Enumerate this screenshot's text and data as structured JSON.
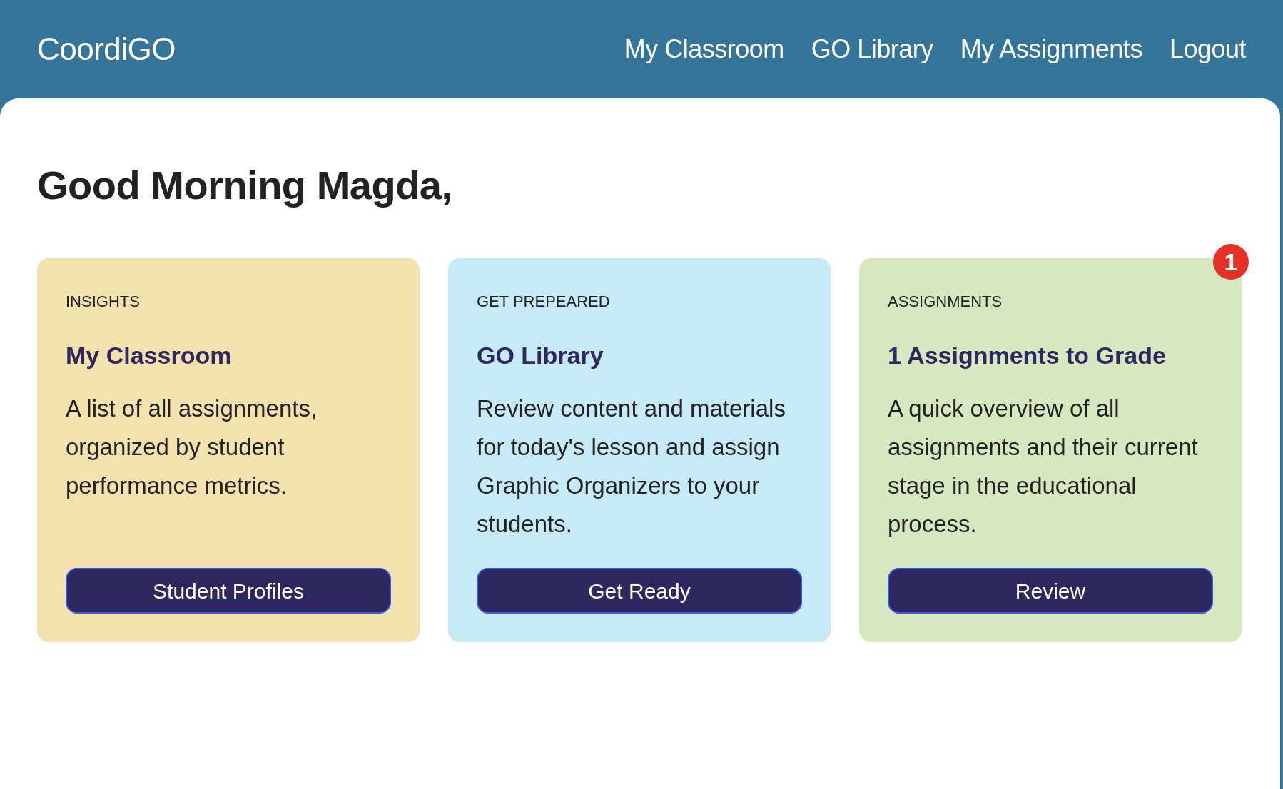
{
  "brand": "CoordiGO",
  "nav": [
    {
      "label": "My Classroom"
    },
    {
      "label": "GO Library"
    },
    {
      "label": "My Assignments"
    },
    {
      "label": "Logout"
    }
  ],
  "greeting": "Good Morning Magda,",
  "cards": [
    {
      "category": "INSIGHTS",
      "title": "My Classroom",
      "description": "A list of all assignments, organized by student performance metrics.",
      "button": "Student Profiles",
      "color": "#f3e2ae"
    },
    {
      "category": "GET PREPEARED",
      "title": "GO Library",
      "description": "Review content and materials for today's lesson and assign Graphic Organizers to your students.",
      "button": "Get Ready",
      "color": "#c6eaf8"
    },
    {
      "category": "ASSIGNMENTS",
      "title": "1 Assignments to Grade",
      "description": "A quick overview of all assignments and their current stage in the educational process.",
      "button": "Review",
      "color": "#d6e8bf",
      "badge": "1"
    }
  ]
}
